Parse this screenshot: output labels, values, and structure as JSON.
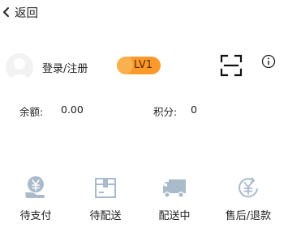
{
  "header": {
    "back_label": "返回"
  },
  "profile": {
    "login_label": "登录/注册",
    "level_badge": "LV1"
  },
  "balance": {
    "balance_label": "余额:",
    "balance_value": "0.00",
    "points_label": "积分:",
    "points_value": "0"
  },
  "orders": [
    {
      "label": "待支付",
      "icon": "pay-money-icon"
    },
    {
      "label": "待配送",
      "icon": "package-box-icon"
    },
    {
      "label": "配送中",
      "icon": "delivery-truck-icon"
    },
    {
      "label": "售后/退款",
      "icon": "refund-icon"
    }
  ],
  "colors": {
    "accent": "#fb9a2b",
    "icon_blue": "#a9bbcb"
  }
}
